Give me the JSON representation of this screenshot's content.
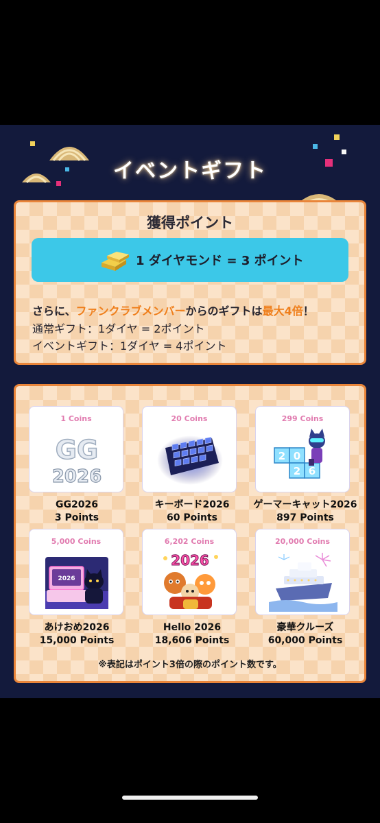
{
  "event": {
    "title": "イベントギフト",
    "points_heading": "獲得ポイント",
    "rate_text": "1 ダイヤモンド = 3 ポイント",
    "bonus_line": {
      "prefix": "さらに、",
      "highlight": "ファンクラブメンバー",
      "middle": "からのギフトは",
      "max": "最大4倍",
      "suffix": "！"
    },
    "normal_gift": "通常ギフト：1ダイヤ = 2ポイント",
    "event_gift": "イベントギフト：1ダイヤ = 4ポイント",
    "note": "※表記はポイント3倍の際のポイント数です。",
    "colors": {
      "accent": "#ef7e1a",
      "banner_bg": "#131a3c",
      "rate_bg": "#3cc8e8",
      "coins_text": "#e17cb0"
    }
  },
  "gifts": [
    {
      "coins": "1 Coins",
      "name": "GG2026",
      "points": "3 Points",
      "icon": "gg2026-text-art"
    },
    {
      "coins": "20 Coins",
      "name": "キーボード2026",
      "points": "60 Points",
      "icon": "keyboard-icon"
    },
    {
      "coins": "299 Coins",
      "name": "ゲーマーキャット2026",
      "points": "897 Points",
      "icon": "gamer-cat-icon"
    },
    {
      "coins": "5,000 Coins",
      "name": "あけおめ2026",
      "points": "15,000 Points",
      "icon": "akeome-desk-icon"
    },
    {
      "coins": "6,202 Coins",
      "name": "Hello 2026",
      "points": "18,606 Points",
      "icon": "hello-2026-characters-icon"
    },
    {
      "coins": "20,000 Coins",
      "name": "豪華クルーズ",
      "points": "60,000 Points",
      "icon": "cruise-ship-icon"
    }
  ],
  "art_text": {
    "gg_top": "GG",
    "gg_bottom": "2026",
    "cat_digits": "2026",
    "akeome_label": "2026",
    "hello_label": "2026"
  }
}
